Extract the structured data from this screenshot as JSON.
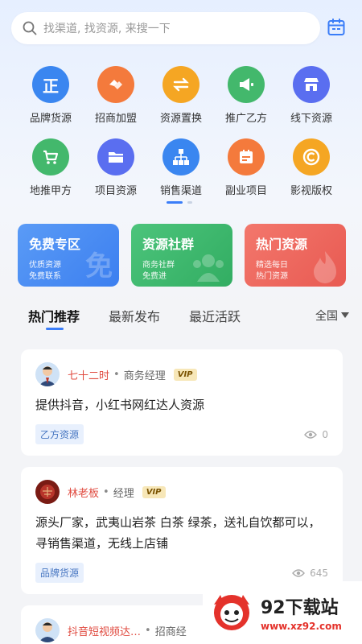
{
  "search": {
    "placeholder": "找渠道, 找资源, 来搜一下"
  },
  "categories": [
    {
      "label": "品牌货源",
      "icon": "zheng-badge-icon",
      "color": "#3a86f0"
    },
    {
      "label": "招商加盟",
      "icon": "handshake-icon",
      "color": "#f47a3c"
    },
    {
      "label": "资源置换",
      "icon": "exchange-arrows-icon",
      "color": "#f5a623"
    },
    {
      "label": "推广乙方",
      "icon": "megaphone-icon",
      "color": "#43b86c"
    },
    {
      "label": "线下资源",
      "icon": "store-icon",
      "color": "#5a6ef0"
    },
    {
      "label": "地推甲方",
      "icon": "cart-icon",
      "color": "#43b86c"
    },
    {
      "label": "项目资源",
      "icon": "folder-icon",
      "color": "#5a6ef0"
    },
    {
      "label": "销售渠道",
      "icon": "org-chart-icon",
      "color": "#3a86f0"
    },
    {
      "label": "副业项目",
      "icon": "calendar-task-icon",
      "color": "#f47a3c"
    },
    {
      "label": "影视版权",
      "icon": "copyright-icon",
      "color": "#f5a623"
    }
  ],
  "promos": [
    {
      "title": "免费专区",
      "line1": "优质资源",
      "line2": "免费联系",
      "wm": "免",
      "color": "#4a8cf2"
    },
    {
      "title": "资源社群",
      "line1": "商务社群",
      "line2": "免费进",
      "color": "#3db86d"
    },
    {
      "title": "热门资源",
      "line1": "精选每日",
      "line2": "热门资源",
      "color": "#ef6a5f"
    }
  ],
  "tabs": {
    "t1": "热门推荐",
    "t2": "最新发布",
    "t3": "最近活跃",
    "region": "全国"
  },
  "posts": [
    {
      "name": "七十二时",
      "role": "商务经理",
      "vip": "VIP",
      "content": "提供抖音，小红书网红达人资源",
      "tag": "乙方资源",
      "views": "0"
    },
    {
      "name": "林老板",
      "role": "经理",
      "vip": "VIP",
      "content": "源头厂家，武夷山岩茶 白茶 绿茶，送礼自饮都可以，寻销售渠道，无线上店铺",
      "tag": "品牌货源",
      "views": "645"
    },
    {
      "name": "抖音短视频达…",
      "role": "招商经"
    }
  ],
  "watermark": {
    "brand": "92下载站",
    "url": "www.xz92.com"
  }
}
